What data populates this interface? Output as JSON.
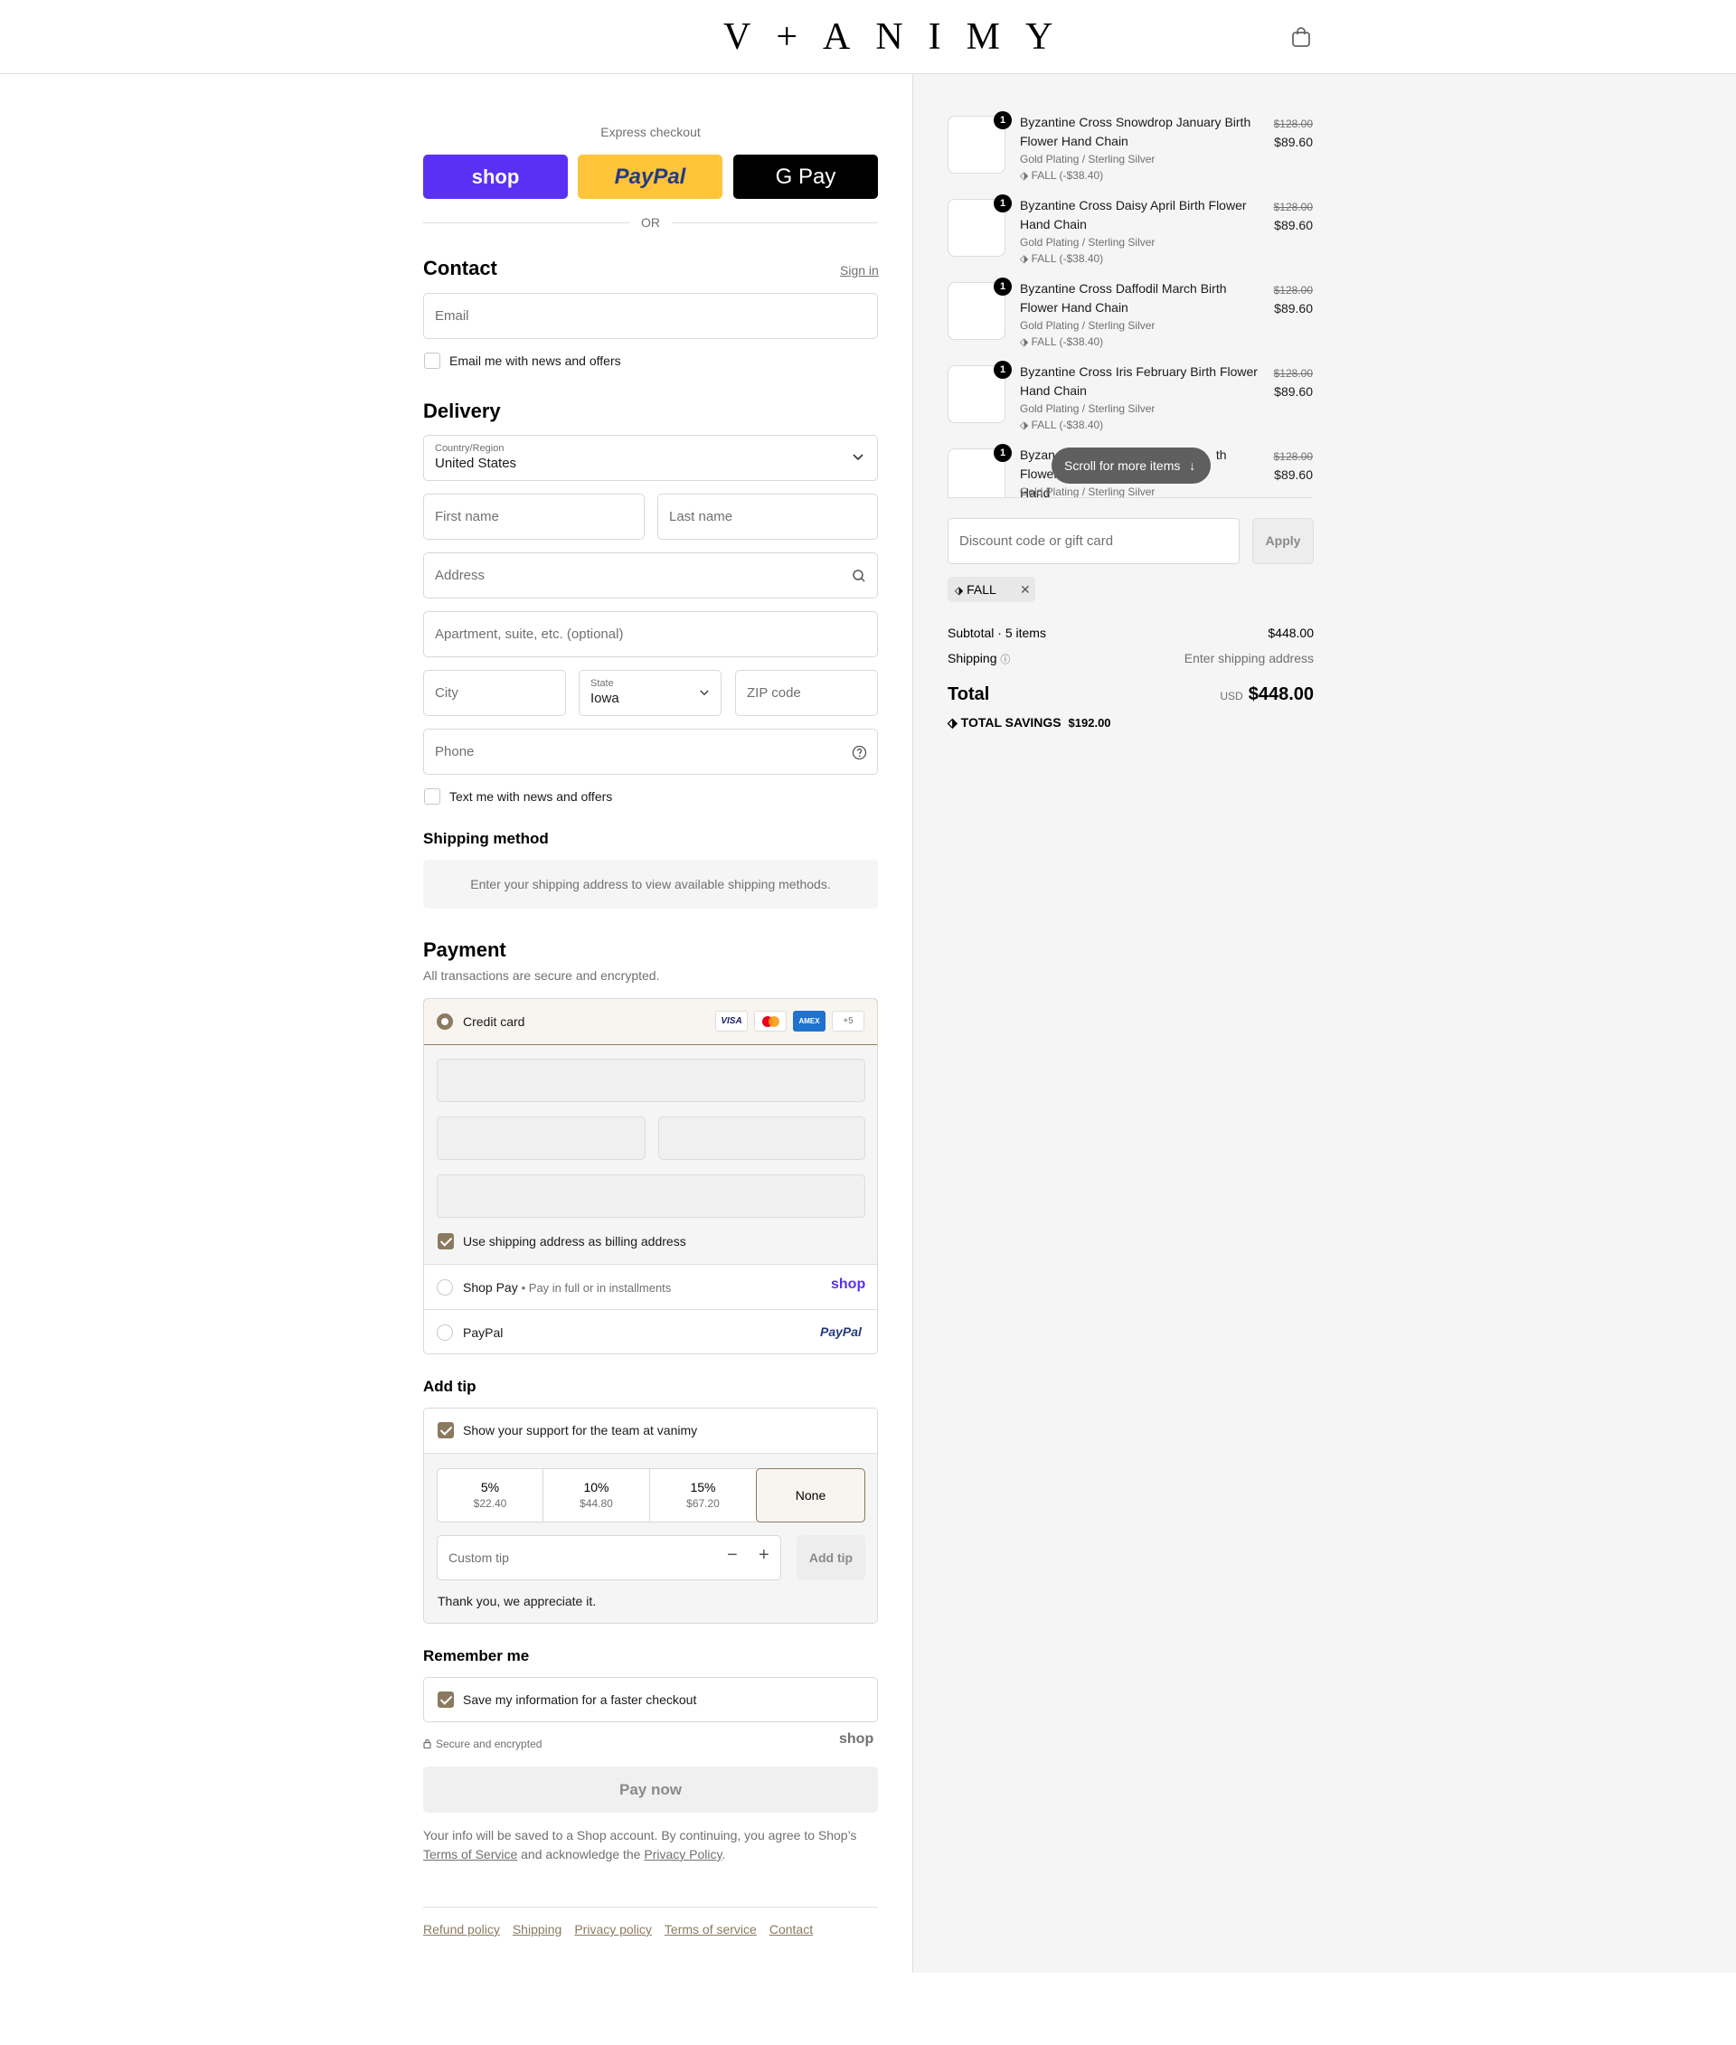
{
  "header": {
    "logo": "V+ANIMY",
    "cart_icon": "shopping-bag-icon"
  },
  "express": {
    "title": "Express checkout",
    "buttons": [
      {
        "label": "shop",
        "color": "#5a31f4"
      },
      {
        "label": "PayPal",
        "color": "#ffc439"
      },
      {
        "label": "G Pay",
        "color": "#000000"
      }
    ],
    "or": "OR"
  },
  "contact": {
    "title": "Contact",
    "sign_in": "Sign in",
    "email_placeholder": "Email",
    "news_label": "Email me with news and offers"
  },
  "delivery": {
    "title": "Delivery",
    "country_label": "Country/Region",
    "country_value": "United States",
    "first_name": "First name",
    "last_name": "Last name",
    "address": "Address",
    "apartment": "Apartment, suite, etc. (optional)",
    "city": "City",
    "state_label": "State",
    "state_value": "Iowa",
    "zip": "ZIP code",
    "phone": "Phone",
    "text_label": "Text me with news and offers"
  },
  "shipping_method": {
    "title": "Shipping method",
    "notice": "Enter your shipping address to view available shipping methods."
  },
  "payment": {
    "title": "Payment",
    "subtitle": "All transactions are secure and encrypted.",
    "credit_card": "Credit card",
    "card_brands": [
      "VISA",
      "MC",
      "AMEX",
      "+5"
    ],
    "billing_label": "Use shipping address as billing address",
    "shop_pay": "Shop Pay",
    "shop_pay_sub": "Pay in full or in installments",
    "shop_pay_logo": "shop",
    "paypal": "PayPal",
    "paypal_logo": "PayPal"
  },
  "tip": {
    "title": "Add tip",
    "support_label": "Show your support for the team at vanimy",
    "options": [
      {
        "pct": "5%",
        "amount": "$22.40"
      },
      {
        "pct": "10%",
        "amount": "$44.80"
      },
      {
        "pct": "15%",
        "amount": "$67.20"
      },
      {
        "pct": "None",
        "amount": ""
      }
    ],
    "custom_placeholder": "Custom tip",
    "add_button": "Add tip",
    "thanks": "Thank you, we appreciate it."
  },
  "remember": {
    "title": "Remember me",
    "save_label": "Save my information for a faster checkout",
    "secure": "Secure and encrypted",
    "shop_logo": "shop"
  },
  "pay_now": "Pay now",
  "legal": {
    "text1": "Your info will be saved to a Shop account. By continuing, you agree to Shop’s",
    "terms": "Terms of Service",
    "text2": "and acknowledge the",
    "privacy": "Privacy Policy",
    "text3": "."
  },
  "footer_links": [
    "Refund policy",
    "Shipping",
    "Privacy policy",
    "Terms of service",
    "Contact"
  ],
  "cart": {
    "items": [
      {
        "qty": "1",
        "name": "Byzantine Cross Snowdrop January Birth Flower Hand Chain",
        "variant": "Gold Plating / Sterling Silver",
        "discount": "FALL (-$38.40)",
        "old_price": "$128.00",
        "price": "$89.60"
      },
      {
        "qty": "1",
        "name": "Byzantine Cross Daisy April Birth Flower Hand Chain",
        "variant": "Gold Plating / Sterling Silver",
        "discount": "FALL (-$38.40)",
        "old_price": "$128.00",
        "price": "$89.60"
      },
      {
        "qty": "1",
        "name": "Byzantine Cross Daffodil March Birth Flower Hand Chain",
        "variant": "Gold Plating / Sterling Silver",
        "discount": "FALL (-$38.40)",
        "old_price": "$128.00",
        "price": "$89.60"
      },
      {
        "qty": "1",
        "name": "Byzantine Cross Iris February Birth Flower Hand Chain",
        "variant": "Gold Plating / Sterling Silver",
        "discount": "FALL (-$38.40)",
        "old_price": "$128.00",
        "price": "$89.60"
      },
      {
        "qty": "1",
        "name_start": "Byzan",
        "name_end": "th Flower",
        "name_line2": "Hand",
        "variant": "Gold Plating / Sterling Silver",
        "old_price": "$128.00",
        "price": "$89.60"
      }
    ],
    "scroll_hint": "Scroll for more items",
    "discount_placeholder": "Discount code or gift card",
    "apply": "Apply",
    "code_tag": "FALL",
    "subtotal_label": "Subtotal · 5 items",
    "subtotal_value": "$448.00",
    "shipping_label": "Shipping",
    "shipping_value": "Enter shipping address",
    "total_label": "Total",
    "currency": "USD",
    "total_value": "$448.00",
    "savings_label": "TOTAL SAVINGS",
    "savings_value": "$192.00"
  },
  "colors": {
    "accent": "#8a7a60",
    "shop_purple": "#5a31f4",
    "paypal_yellow": "#ffc439"
  }
}
